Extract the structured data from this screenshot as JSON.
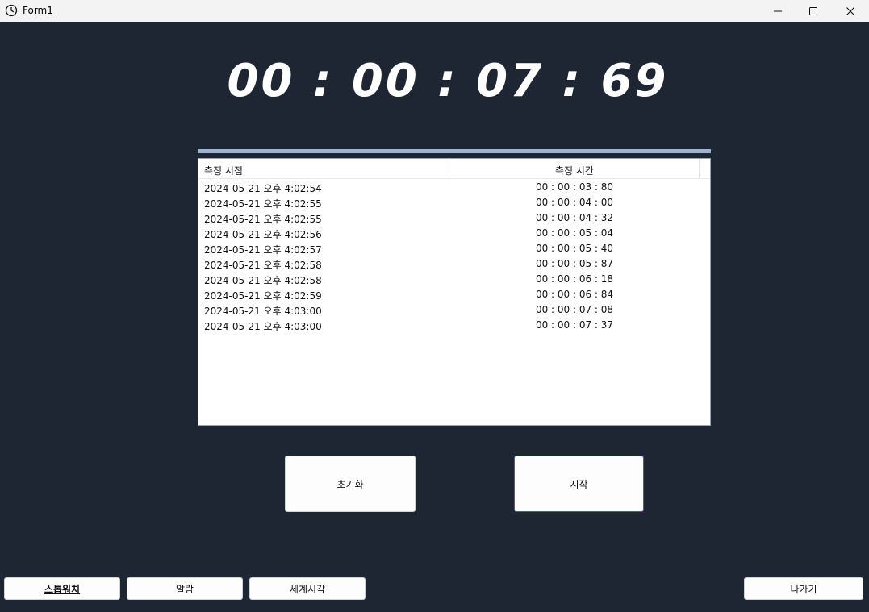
{
  "window": {
    "title": "Form1",
    "icon": "clock-icon"
  },
  "clock": {
    "display": "00 : 00 : 07 : 69"
  },
  "laps": {
    "headers": [
      "측정 시점",
      "측정 시간"
    ],
    "rows": [
      [
        "2024-05-21 오후 4:02:54",
        "00 : 00 : 03 : 80"
      ],
      [
        "2024-05-21 오후 4:02:55",
        "00 : 00 : 04 : 00"
      ],
      [
        "2024-05-21 오후 4:02:55",
        "00 : 00 : 04 : 32"
      ],
      [
        "2024-05-21 오후 4:02:56",
        "00 : 00 : 05 : 04"
      ],
      [
        "2024-05-21 오후 4:02:57",
        "00 : 00 : 05 : 40"
      ],
      [
        "2024-05-21 오후 4:02:58",
        "00 : 00 : 05 : 87"
      ],
      [
        "2024-05-21 오후 4:02:58",
        "00 : 00 : 06 : 18"
      ],
      [
        "2024-05-21 오후 4:02:59",
        "00 : 00 : 06 : 84"
      ],
      [
        "2024-05-21 오후 4:03:00",
        "00 : 00 : 07 : 08"
      ],
      [
        "2024-05-21 오후 4:03:00",
        "00 : 00 : 07 : 37"
      ]
    ]
  },
  "controls": {
    "reset_label": "초기화",
    "start_label": "시작"
  },
  "nav": {
    "stopwatch_label": "스톱워치",
    "alarm_label": "알람",
    "world_clock_label": "세계시각",
    "exit_label": "나가기"
  },
  "colors": {
    "background": "#1f2633",
    "accent_bar": "#9db5d2",
    "focus_border": "#1a6fc9"
  }
}
